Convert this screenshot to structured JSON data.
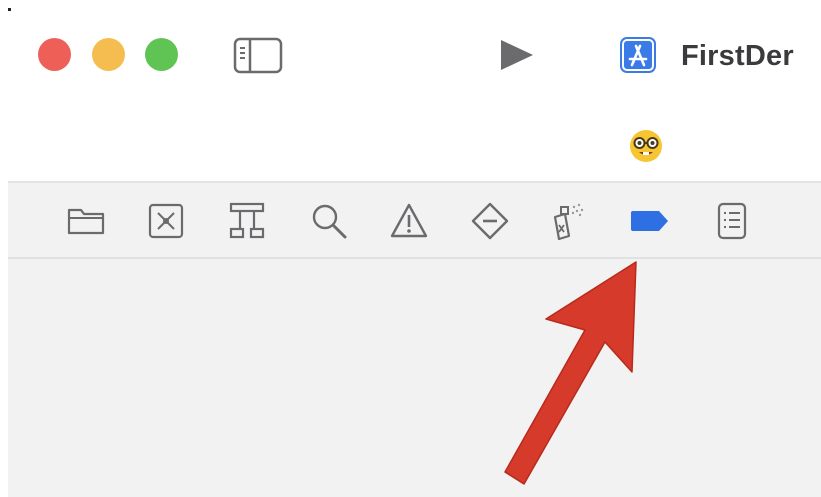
{
  "window": {
    "scheme_name": "FirstDer",
    "traffic_lights": {
      "close": "#ee5f57",
      "minimize": "#f5bd4f",
      "zoom": "#5fc454"
    }
  },
  "navigator": {
    "tabs": [
      {
        "name": "project-navigator",
        "icon": "folder-icon"
      },
      {
        "name": "source-control-navigator",
        "icon": "source-control-icon"
      },
      {
        "name": "symbol-navigator",
        "icon": "hierarchy-icon"
      },
      {
        "name": "find-navigator",
        "icon": "magnifier-icon"
      },
      {
        "name": "issue-navigator",
        "icon": "warning-icon"
      },
      {
        "name": "test-navigator",
        "icon": "diamond-minus-icon"
      },
      {
        "name": "debug-navigator",
        "icon": "spray-bottle-icon"
      },
      {
        "name": "breakpoint-navigator",
        "icon": "breakpoint-tag-icon",
        "selected": true
      },
      {
        "name": "report-navigator",
        "icon": "list-icon"
      }
    ],
    "accent_color": "#2f6fe4"
  },
  "annotation": {
    "arrow_color": "#d63a2a"
  }
}
